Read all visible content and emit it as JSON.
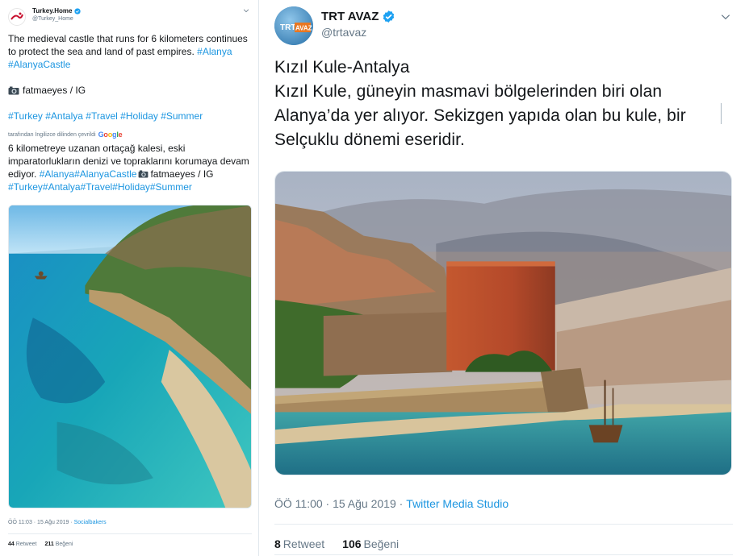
{
  "left_tweet": {
    "account_name": "Turkey.Home",
    "handle": "@Turkey_Home",
    "body_text": "The medieval castle that runs for 6 kilometers continues to protect the sea and land of past empires.",
    "body_hashtags": "#Alanya #AlanyaCastle",
    "credit": "fatmaeyes / IG",
    "hashtags": "#Turkey #Antalya #Travel #Holiday #Summer",
    "translated_by": "tarafından İngilizce dilinden çevrildi",
    "google_label": "Google",
    "translation_text": "6 kilometreye uzanan ortaçağ kalesi, eski imparatorlukların denizi ve topraklarını korumaya devam ediyor.",
    "translation_hashtags": "#Alanya#AlanyaCastle",
    "translation_credit": "fatmaeyes / IG",
    "translation_tags": "#Turkey#Antalya#Travel#Holiday#Summer",
    "timestamp": "ÖÖ 11:03 · 15 Ağu 2019 ·",
    "source": "Socialbakers",
    "retweet_count": "44",
    "retweet_label": "Retweet",
    "like_count": "211",
    "like_label": "Beğeni"
  },
  "right_tweet": {
    "account_name": "TRT AVAZ",
    "handle": "@trtavaz",
    "avatar_text_1": "TRT",
    "avatar_text_2": "AVAZ",
    "text_line_1": "Kızıl Kule-Antalya",
    "text_line_2": "Kızıl Kule, güneyin masmavi bölgelerinden biri olan",
    "text_line_3": "Alanya’da yer alıyor. Sekizgen yapıda olan bu kule, bir",
    "text_line_4": "Selçuklu dönemi eseridir.",
    "timestamp": "ÖÖ 11:00 · 15 Ağu 2019 ·",
    "source": "Twitter Media Studio",
    "retweet_count": "8",
    "retweet_label": "Retweet",
    "like_count": "106",
    "like_label": "Beğeni"
  },
  "colors": {
    "link_blue": "#1b95e0",
    "secondary_text": "#657786",
    "primary_text": "#14171a",
    "verified_blue": "#1da1f2"
  },
  "icons": [
    "turkey-home-logo-icon",
    "verified-badge-icon",
    "chevron-down-icon",
    "camera-icon",
    "trt-avaz-logo-icon"
  ]
}
